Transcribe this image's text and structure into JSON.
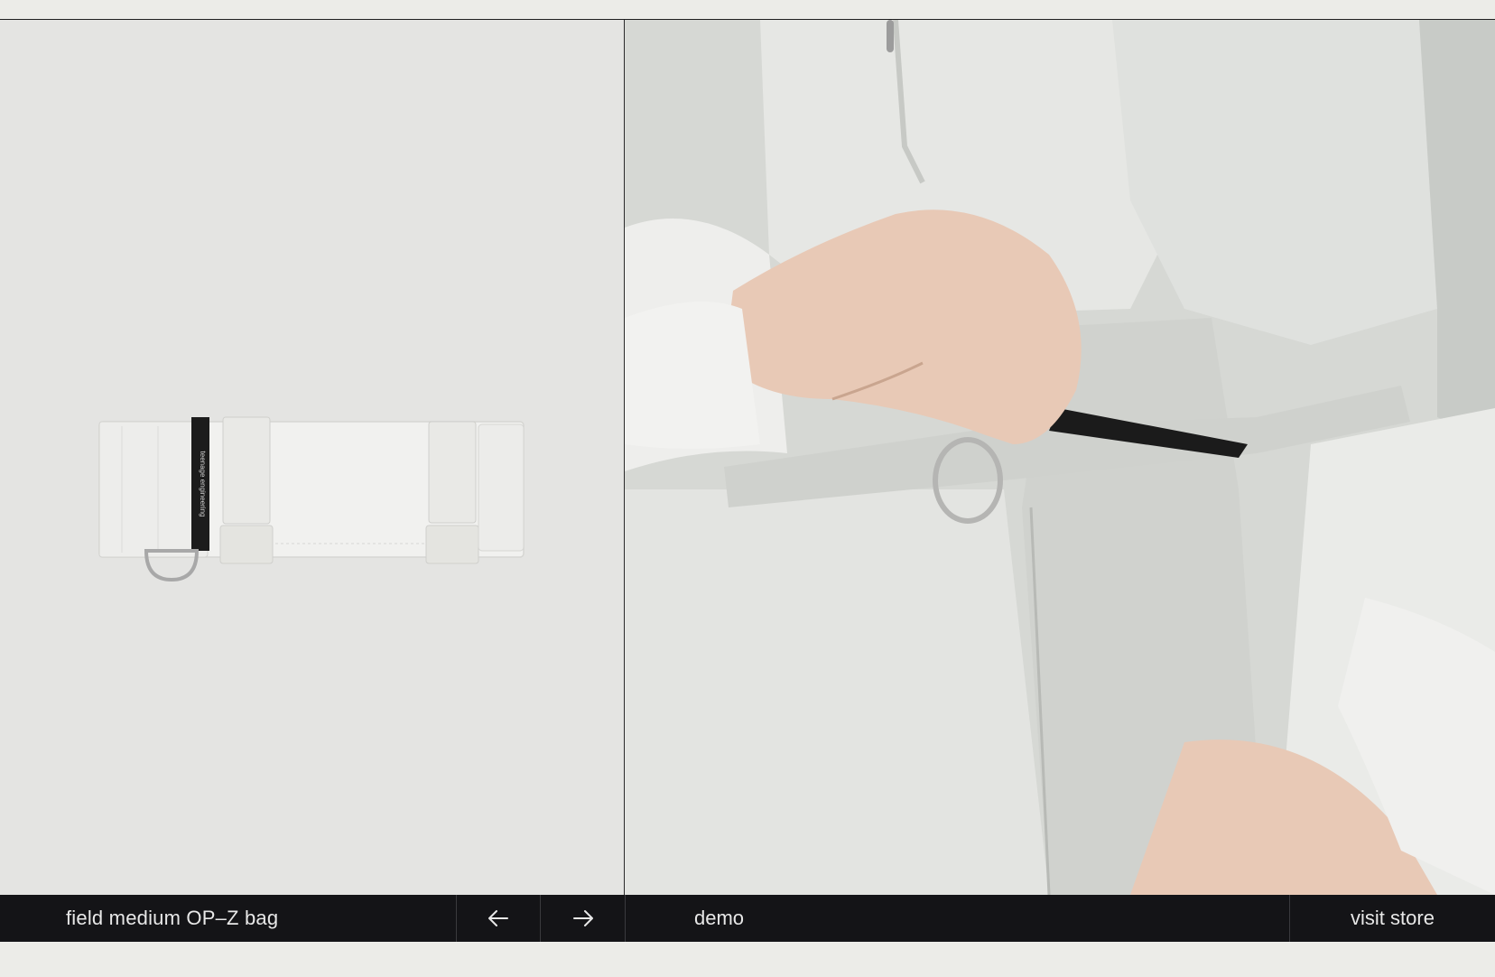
{
  "product": {
    "name": "field medium OP–Z bag",
    "image_alt": "white fabric belt bag product image",
    "strap_text": "teenage engineering"
  },
  "navigation": {
    "prev_icon": "arrow-left-icon",
    "next_icon": "arrow-right-icon"
  },
  "demo": {
    "label": "demo",
    "image_alt": "person in white jacket adjusting belt bag"
  },
  "store": {
    "label": "visit store"
  },
  "colors": {
    "bar_background": "#141417",
    "bar_text": "#e8e8e8",
    "page_background": "#ecece8",
    "product_background": "#e4e4e2"
  }
}
